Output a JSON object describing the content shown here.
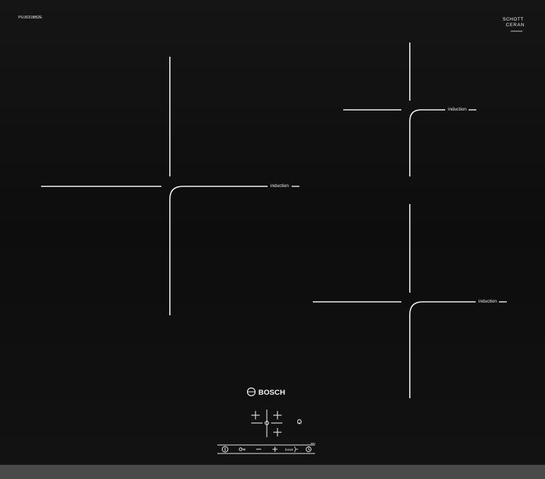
{
  "hob": {
    "model_number": "PUJ631BB2E",
    "ceran_brand_top": "SCHOTT",
    "ceran_brand_bottom": "CERAN",
    "ceran_subtext": "0000000000",
    "brand": "BOSCH",
    "zone_label": "induction",
    "boost_label": "boost",
    "min_label": "min",
    "surface_color": "#0f0f0f",
    "frame_color": "#3a3a3a",
    "line_color": "#f5f5f5"
  },
  "zones": [
    {
      "name": "left",
      "label": "induction"
    },
    {
      "name": "top-right",
      "label": "induction"
    },
    {
      "name": "bottom-right",
      "label": "induction"
    }
  ],
  "controls": {
    "icons": [
      "power-icon",
      "key-lock-icon",
      "minus-icon",
      "plus-icon",
      "boost-icon",
      "timer-icon"
    ],
    "zone_selector_icons": [
      "zone-select-top-left-icon",
      "zone-select-top-right-icon",
      "zone-select-center-icon",
      "zone-select-bottom-right-icon"
    ],
    "indicator_icon": "bell-icon"
  }
}
